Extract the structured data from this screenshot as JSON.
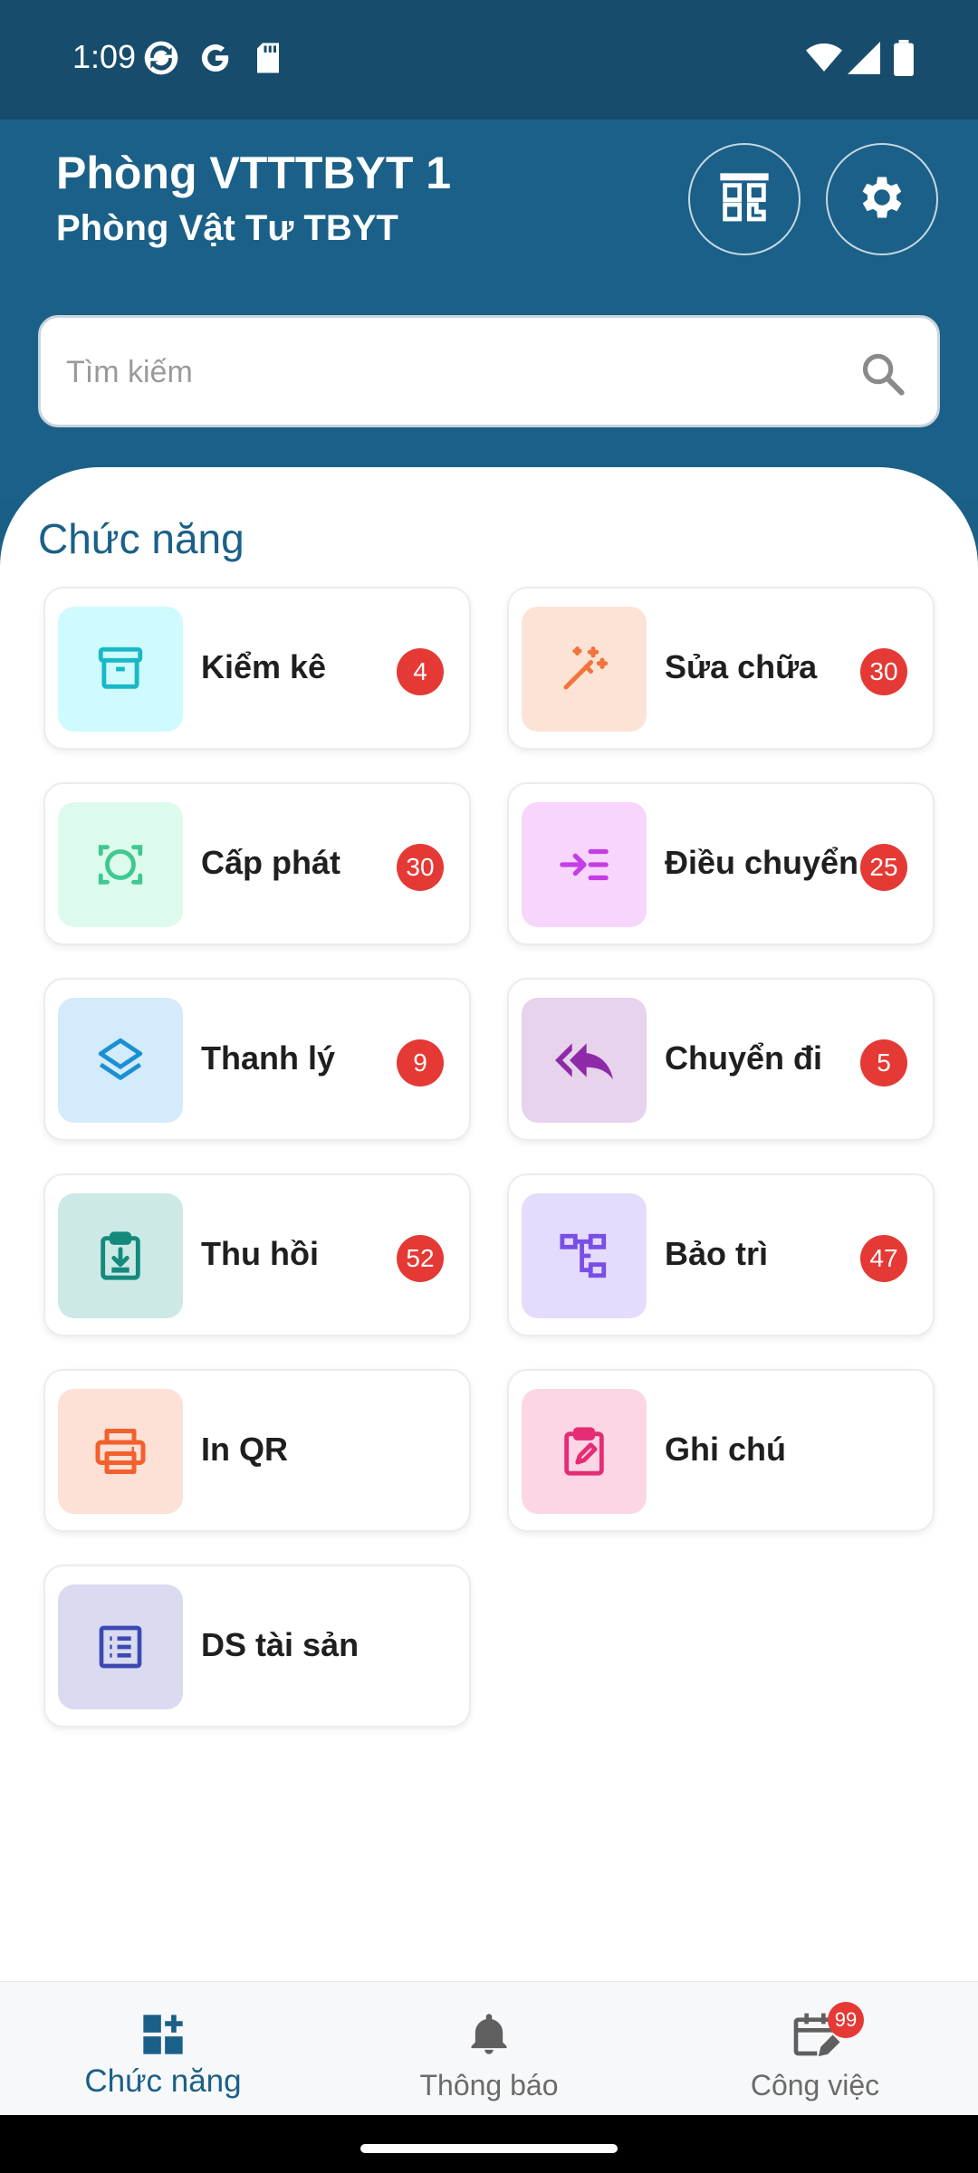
{
  "status_bar": {
    "time": "1:09",
    "left_icons": [
      "sync-icon",
      "google-icon",
      "sd-card-icon"
    ],
    "right_icons": [
      "wifi-icon",
      "signal-icon",
      "battery-icon"
    ]
  },
  "header": {
    "title": "Phòng VTTTBYT 1",
    "subtitle": "Phòng Vật Tư TBYT",
    "actions": [
      "qr-scan-icon",
      "settings-icon"
    ]
  },
  "search": {
    "placeholder": "Tìm kiếm",
    "value": ""
  },
  "section": {
    "title": "Chức năng"
  },
  "functions": [
    {
      "label": "Kiểm kê",
      "badge": "4",
      "icon": "archive-icon",
      "icon_color": "#17b8c7",
      "bg": "#cffafe"
    },
    {
      "label": "Sửa chữa",
      "badge": "30",
      "icon": "magic-wand-icon",
      "icon_color": "#f2743c",
      "bg": "#fde3d6"
    },
    {
      "label": "Cấp phát",
      "badge": "30",
      "icon": "focus-frame-icon",
      "icon_color": "#3fc890",
      "bg": "#dcfbec"
    },
    {
      "label": "Điều chuyển",
      "badge": "25",
      "icon": "indent-icon",
      "icon_color": "#c43de6",
      "bg": "#f8d5fd"
    },
    {
      "label": "Thanh lý",
      "badge": "9",
      "icon": "layers-icon",
      "icon_color": "#1a8fd6",
      "bg": "#d3ebfa"
    },
    {
      "label": "Chuyển đi",
      "badge": "5",
      "icon": "reply-all-icon",
      "icon_color": "#8e2aa8",
      "bg": "#e7d3ec"
    },
    {
      "label": "Thu hồi",
      "badge": "52",
      "icon": "clipboard-download-icon",
      "icon_color": "#138a7c",
      "bg": "#cce9e6"
    },
    {
      "label": "Bảo trì",
      "badge": "47",
      "icon": "hierarchy-icon",
      "icon_color": "#7a4fe6",
      "bg": "#e5dcfd"
    },
    {
      "label": "In QR",
      "badge": "",
      "icon": "printer-icon",
      "icon_color": "#f2612d",
      "bg": "#fde0d6"
    },
    {
      "label": "Ghi chú",
      "badge": "",
      "icon": "clipboard-edit-icon",
      "icon_color": "#e52c74",
      "bg": "#fdd6e6"
    },
    {
      "label": "DS tài sản",
      "badge": "",
      "icon": "list-icon",
      "icon_color": "#3c49b3",
      "bg": "#dadbf0"
    }
  ],
  "bottom_nav": [
    {
      "label": "Chức năng",
      "icon": "dashboard-add-icon",
      "active": true
    },
    {
      "label": "Thông báo",
      "icon": "bell-icon",
      "active": false
    },
    {
      "label": "Công việc",
      "icon": "calendar-edit-icon",
      "active": false,
      "badge": "99"
    }
  ],
  "colors": {
    "primary": "#1a6088",
    "status_bar": "#174c6c",
    "badge": "#e53935"
  }
}
